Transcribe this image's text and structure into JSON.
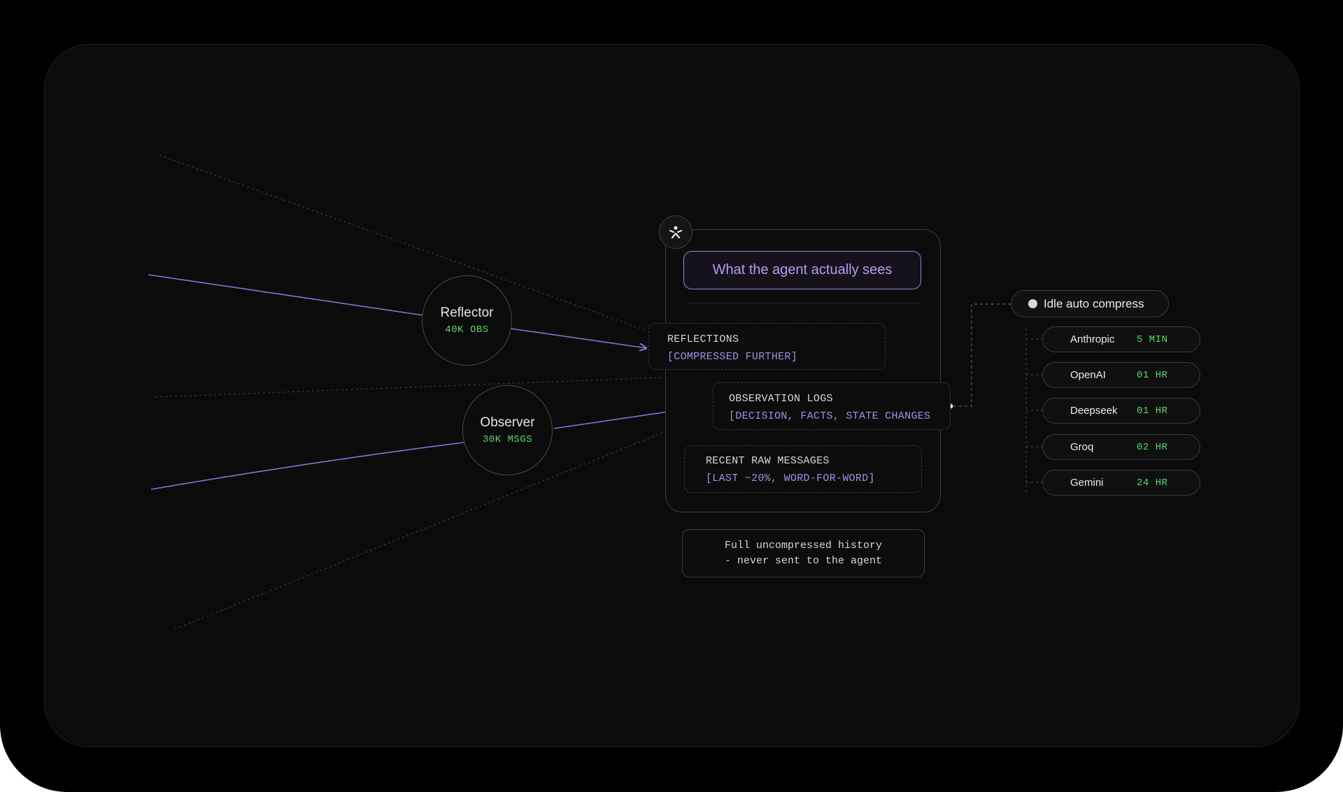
{
  "colors": {
    "frame": "#000000",
    "panel": "#0b0b0b",
    "accent_purple": "#a88de8",
    "accent_green": "#59d96a",
    "text": "#e6e6e6"
  },
  "nodes": {
    "reflector": {
      "title": "Reflector",
      "sub": "40K OBS"
    },
    "observer": {
      "title": "Observer",
      "sub": "30K MSGS"
    }
  },
  "agent_view": {
    "icon": "agent-logo-icon",
    "title": "What the agent actually sees",
    "sections": [
      {
        "title": "REFLECTIONS",
        "sub": "[COMPRESSED FURTHER]"
      },
      {
        "title": "OBSERVATION LOGS",
        "sub": "[DECISION, FACTS, STATE CHANGES"
      },
      {
        "title": "RECENT RAW MESSAGES",
        "sub": "[LAST ~20%, WORD-FOR-WORD]"
      }
    ]
  },
  "history_note": {
    "line1": "Full uncompressed history",
    "line2": "- never sent to the agent"
  },
  "idle": {
    "label": "Idle auto compress"
  },
  "providers": [
    {
      "name": "Anthropic",
      "value": "5 MIN"
    },
    {
      "name": "OpenAI",
      "value": "01 HR"
    },
    {
      "name": "Deepseek",
      "value": "01 HR"
    },
    {
      "name": "Groq",
      "value": "02 HR"
    },
    {
      "name": "Gemini",
      "value": "24 HR"
    }
  ]
}
